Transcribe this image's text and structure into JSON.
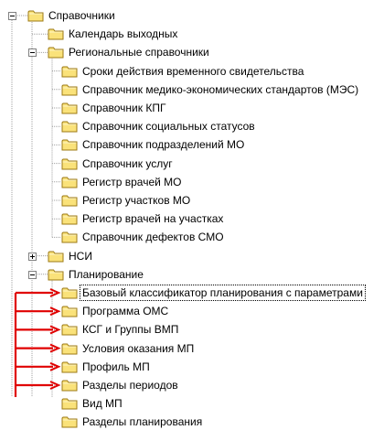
{
  "tree": {
    "root": {
      "label": "Справочники",
      "expanded": true
    },
    "items": [
      {
        "label": "Календарь выходных",
        "level": 1
      },
      {
        "label": "Региональные справочники",
        "level": 1,
        "expanded": true
      },
      {
        "label": "Сроки действия временного свидетельства",
        "level": 2
      },
      {
        "label": "Справочник медико-экономических стандартов (МЭС)",
        "level": 2
      },
      {
        "label": "Справочник КПГ",
        "level": 2
      },
      {
        "label": "Справочник социальных статусов",
        "level": 2
      },
      {
        "label": "Справочник подразделений МО",
        "level": 2
      },
      {
        "label": "Справочник услуг",
        "level": 2
      },
      {
        "label": "Регистр врачей МО",
        "level": 2
      },
      {
        "label": "Регистр участков МО",
        "level": 2
      },
      {
        "label": "Регистр врачей на участках",
        "level": 2
      },
      {
        "label": "Справочник дефектов СМО",
        "level": 2
      },
      {
        "label": "НСИ",
        "level": 1,
        "expanded": false
      },
      {
        "label": "Планирование",
        "level": 1,
        "expanded": true
      },
      {
        "label": "Базовый классификатор планирования с параметрами",
        "level": 2,
        "selected": true,
        "highlighted": true
      },
      {
        "label": "Программа ОМС",
        "level": 2,
        "highlighted": true
      },
      {
        "label": "КСГ и Группы ВМП",
        "level": 2,
        "highlighted": true
      },
      {
        "label": "Условия оказания МП",
        "level": 2,
        "highlighted": true
      },
      {
        "label": "Профиль МП",
        "level": 2,
        "highlighted": true
      },
      {
        "label": "Разделы периодов",
        "level": 2,
        "highlighted": true
      },
      {
        "label": "Вид МП",
        "level": 2,
        "highlighted": true
      },
      {
        "label": "Разделы планирования",
        "level": 2,
        "highlighted": true
      }
    ]
  },
  "colors": {
    "folder_fill": "#fae27a",
    "folder_border": "#9c7a14",
    "tree_line": "#a0a0a0",
    "arrow": "#e00000"
  },
  "icons": {
    "folder": "folder-icon",
    "expand": "plus-icon",
    "collapse": "minus-icon"
  }
}
